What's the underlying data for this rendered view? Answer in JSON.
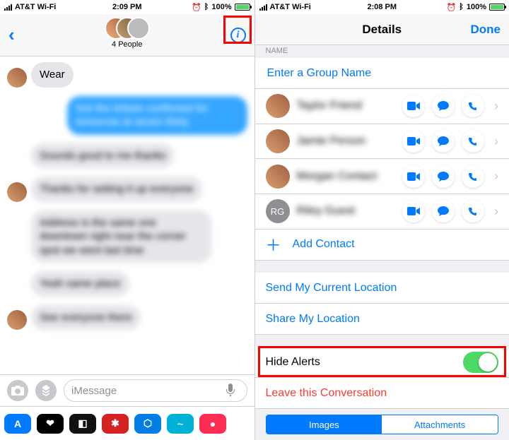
{
  "left": {
    "status": {
      "carrier": "AT&T Wi-Fi",
      "time": "2:09 PM",
      "battery": "100%"
    },
    "header": {
      "subtitle": "4 People",
      "info_label": "i"
    },
    "messages": {
      "m0": "Wear",
      "m1": "Got the tickets confirmed for tomorrow at seven thirty",
      "m2": "Sounds good to me thanks",
      "m3": "Thanks for setting it up everyone",
      "m4": "Address is the same one downtown right near the corner spot we went last time",
      "m5": "Yeah same place",
      "m6": "See everyone there"
    },
    "compose": {
      "placeholder": "iMessage"
    },
    "apps": [
      {
        "bg": "#007aff",
        "label": "A"
      },
      {
        "bg": "#000000",
        "label": "❤"
      },
      {
        "bg": "#111111",
        "label": "◧"
      },
      {
        "bg": "#d32323",
        "label": "✱"
      },
      {
        "bg": "#007ee5",
        "label": "⬡"
      },
      {
        "bg": "#00b2d6",
        "label": "~"
      },
      {
        "bg": "#ff2d55",
        "label": "●"
      }
    ]
  },
  "right": {
    "status": {
      "carrier": "AT&T Wi-Fi",
      "time": "2:08 PM",
      "battery": "100%"
    },
    "nav": {
      "title": "Details",
      "done": "Done"
    },
    "section_name": "Name",
    "group_placeholder": "Enter a Group Name",
    "people": [
      {
        "initials": "",
        "name": "Taylor Friend"
      },
      {
        "initials": "",
        "name": "Jamie Person"
      },
      {
        "initials": "",
        "name": "Morgan Contact"
      },
      {
        "initials": "RG",
        "name": "Riley Guest"
      }
    ],
    "add_contact": "Add Contact",
    "send_location": "Send My Current Location",
    "share_location": "Share My Location",
    "hide_alerts": "Hide Alerts",
    "leave": "Leave this Conversation",
    "seg": {
      "images": "Images",
      "attachments": "Attachments"
    }
  }
}
